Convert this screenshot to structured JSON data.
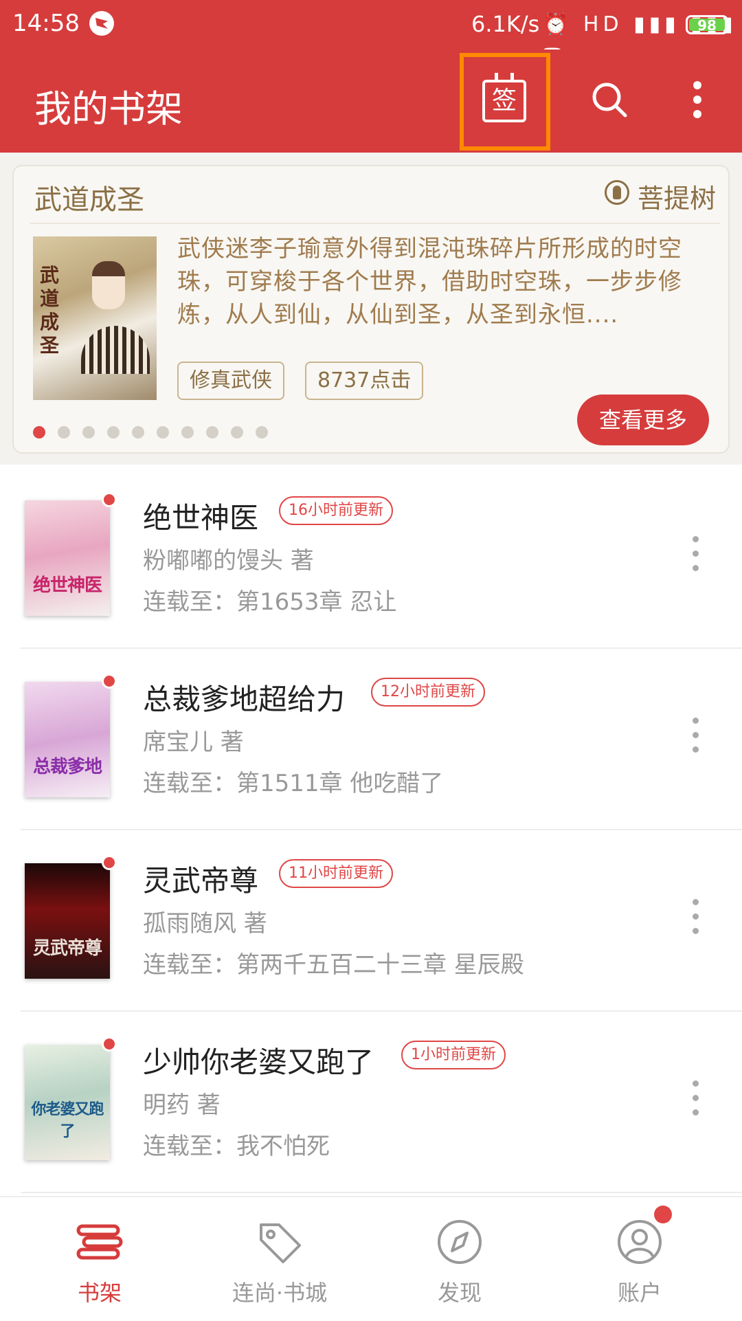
{
  "status_bar": {
    "time": "14:58",
    "network_speed": "6.1K/s",
    "signal_icons": "⏰ HD ▮▮▮ ▮▮▮ ᯤ",
    "battery": "98",
    "battery_color": "#6ad24a"
  },
  "app_bar": {
    "title": "我的书架",
    "signin_label": "签",
    "background": "#d63c3c",
    "highlight_color": "#ff8a00"
  },
  "recommendation": {
    "title": "武道成圣",
    "author": "菩提树",
    "cover_text": "武道成圣",
    "description": "武侠迷李子瑜意外得到混沌珠碎片所形成的时空珠，可穿梭于各个世界，借助时空珠，一步步修炼，从人到仙，从仙到圣，从圣到永恒....",
    "tags": [
      "修真武侠",
      "8737点击"
    ],
    "slide_count": 10,
    "active_slide": 0,
    "more_button": "查看更多"
  },
  "books": [
    {
      "title": "绝世神医",
      "badge": "16小时前更新",
      "author": "粉嘟嘟的馒头 著",
      "chapter": "连载至：第1653章 忍让",
      "cover_text": "绝世神医",
      "has_update_dot": true
    },
    {
      "title": "总裁爹地超给力",
      "badge": "12小时前更新",
      "author": "席宝儿 著",
      "chapter": "连载至：第1511章  他吃醋了",
      "cover_text": "总裁爹地",
      "has_update_dot": true
    },
    {
      "title": "灵武帝尊",
      "badge": "11小时前更新",
      "author": "孤雨随风 著",
      "chapter": "连载至：第两千五百二十三章 星辰殿",
      "cover_text": "灵武帝尊",
      "has_update_dot": true
    },
    {
      "title": "少帅你老婆又跑了",
      "badge": "1小时前更新",
      "author": "明药 著",
      "chapter": "连载至：我不怕死",
      "cover_text": "你老婆又跑了",
      "has_update_dot": true
    }
  ],
  "bottom_nav": [
    {
      "label": "书架",
      "icon": "bookshelf-icon",
      "active": true
    },
    {
      "label": "连尚·书城",
      "icon": "tag-icon",
      "active": false
    },
    {
      "label": "发现",
      "icon": "compass-icon",
      "active": false
    },
    {
      "label": "账户",
      "icon": "user-icon",
      "active": false,
      "badge": true
    }
  ],
  "colors": {
    "accent": "#d63c3c",
    "badge_red": "#e04646",
    "card_text": "#8b6f45"
  }
}
